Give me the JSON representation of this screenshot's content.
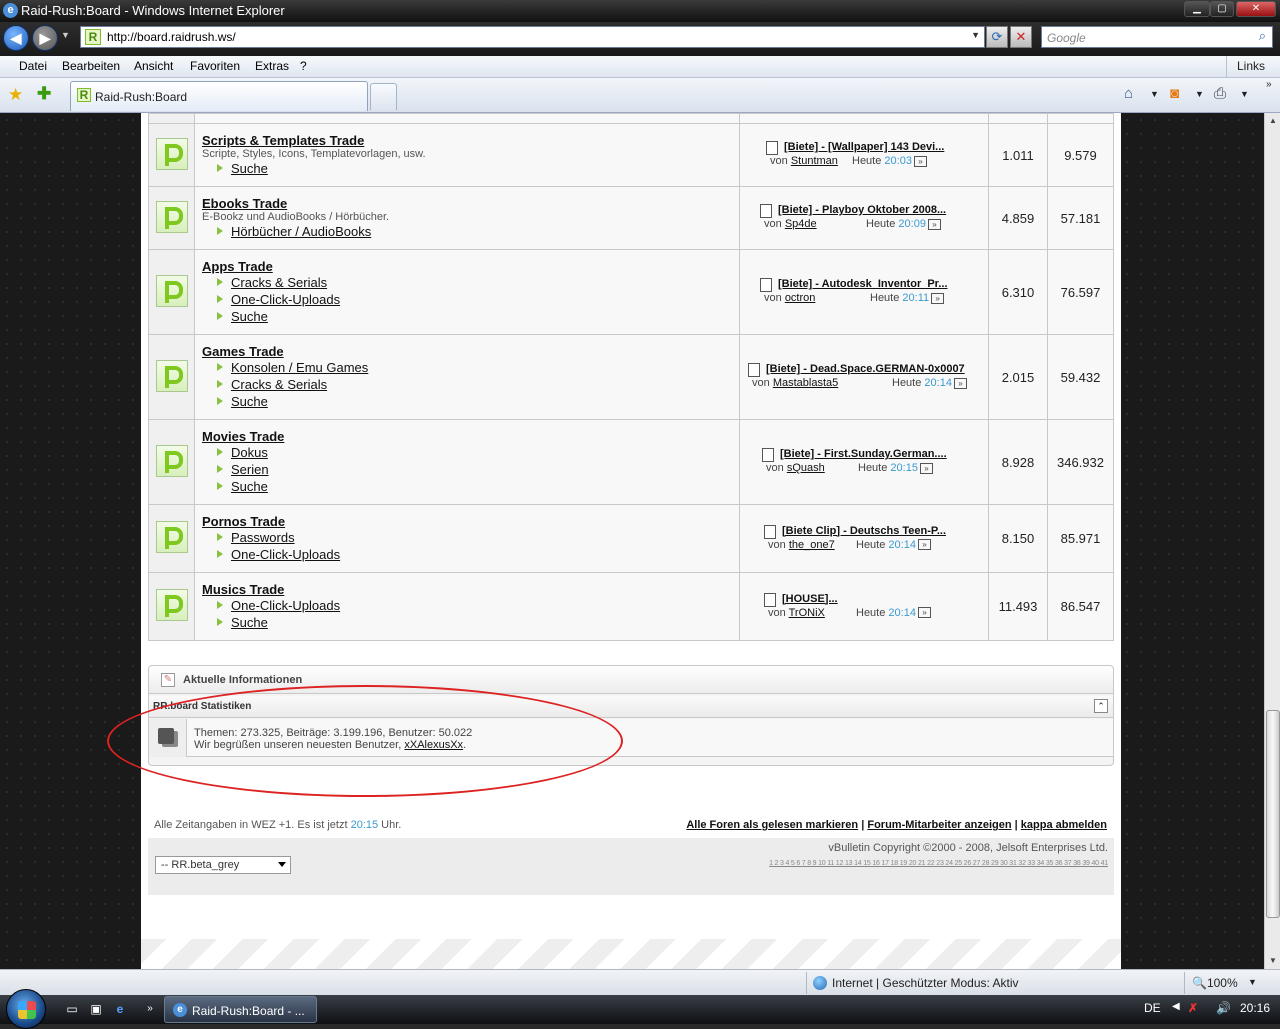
{
  "window": {
    "title": "Raid-Rush:Board - Windows Internet Explorer"
  },
  "address": {
    "url": "http://board.raidrush.ws/",
    "search_placeholder": "Google"
  },
  "menu": {
    "items": [
      "Datei",
      "Bearbeiten",
      "Ansicht",
      "Favoriten",
      "Extras",
      "?"
    ],
    "links": "Links"
  },
  "tab": {
    "label": "Raid-Rush:Board"
  },
  "forums": [
    {
      "title": "Scripts & Templates Trade",
      "desc": "Scripte, Styles, Icons, Templatevorlagen, usw.",
      "subs": [
        "Suche"
      ],
      "lp_title": "[Biete] - [Wallpaper] 143 Devi...",
      "lp_by_label": "von",
      "lp_user": "Stuntman",
      "lp_day": "Heute",
      "lp_time": "20:03",
      "threads": "1.011",
      "posts": "9.579"
    },
    {
      "title": "Ebooks Trade",
      "desc": "E-Bookz und AudioBooks / Hörbücher.",
      "subs": [
        "Hörbücher / AudioBooks"
      ],
      "lp_title": "[Biete] - Playboy Oktober 2008...",
      "lp_by_label": "von",
      "lp_user": "Sp4de",
      "lp_day": "Heute",
      "lp_time": "20:09",
      "threads": "4.859",
      "posts": "57.181"
    },
    {
      "title": "Apps Trade",
      "desc": "",
      "subs": [
        "Cracks & Serials",
        "One-Click-Uploads",
        "Suche"
      ],
      "lp_title": "[Biete] - Autodesk_Inventor_Pr...",
      "lp_by_label": "von",
      "lp_user": "octron",
      "lp_day": "Heute",
      "lp_time": "20:11",
      "threads": "6.310",
      "posts": "76.597"
    },
    {
      "title": "Games Trade",
      "desc": "",
      "subs": [
        "Konsolen / Emu Games",
        "Cracks & Serials",
        "Suche"
      ],
      "lp_title": "[Biete] - Dead.Space.GERMAN-0x0007",
      "lp_by_label": "von",
      "lp_user": "Mastablasta5",
      "lp_day": "Heute",
      "lp_time": "20:14",
      "threads": "2.015",
      "posts": "59.432"
    },
    {
      "title": "Movies Trade",
      "desc": "",
      "subs": [
        "Dokus",
        "Serien",
        "Suche"
      ],
      "lp_title": "[Biete] - First.Sunday.German....",
      "lp_by_label": "von",
      "lp_user": "sQuash",
      "lp_day": "Heute",
      "lp_time": "20:15",
      "threads": "8.928",
      "posts": "346.932"
    },
    {
      "title": "Pornos Trade",
      "desc": "",
      "subs": [
        "Passwords",
        "One-Click-Uploads"
      ],
      "lp_title": "[Biete Clip] - Deutschs Teen-P...",
      "lp_by_label": "von",
      "lp_user": "the_one7",
      "lp_day": "Heute",
      "lp_time": "20:14",
      "threads": "8.150",
      "posts": "85.971"
    },
    {
      "title": "Musics Trade",
      "desc": "",
      "subs": [
        "One-Click-Uploads",
        "Suche"
      ],
      "lp_title": "[HOUSE]...",
      "lp_by_label": "von",
      "lp_user": "TrONiX",
      "lp_day": "Heute",
      "lp_time": "20:14",
      "threads": "11.493",
      "posts": "86.547"
    }
  ],
  "info": {
    "header": "Aktuelle Informationen",
    "stats_title": "RR.board Statistiken",
    "stats_line": "Themen: 273.325, Beiträge: 3.199.196, Benutzer: 50.022",
    "welcome_prefix": "Wir begrüßen unseren neuesten Benutzer,",
    "newest_user": "xXAlexusXx"
  },
  "footer": {
    "tz_prefix": "Alle Zeitangaben in WEZ +1. Es ist jetzt",
    "tz_time": "20:15",
    "tz_suffix": "Uhr.",
    "links": [
      "Alle Foren als gelesen markieren",
      "Forum-Mitarbeiter anzeigen",
      "kappa abmelden"
    ],
    "style_select": "-- RR.beta_grey",
    "copyright": "vBulletin Copyright ©2000 - 2008, Jelsoft Enterprises Ltd.",
    "pages": "1 2 3 4 5 6 7 8 9 10 11 12 13 14 15 16 17 18 19 20 21 22 23 24 25 26 27 28 29 30 31 32 33 34 35 36 37 38 39 40 41"
  },
  "statusbar": {
    "zone": "Internet | Geschützter Modus: Aktiv",
    "zoom": "100%"
  },
  "taskbar": {
    "task_label": "Raid-Rush:Board - ...",
    "lang": "DE",
    "clock": "20:16"
  },
  "colors": {
    "accent_time": "#3a9ad0",
    "highlight_ellipse": "#dd2222",
    "forum_icon": "#7ec820"
  }
}
